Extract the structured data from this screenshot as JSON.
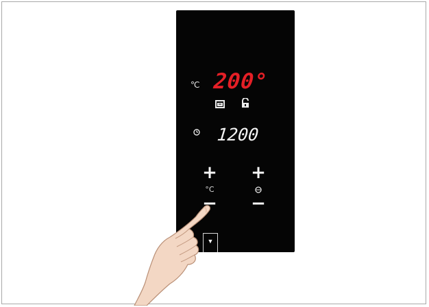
{
  "panel": {
    "temperature": {
      "unit_label": "°C",
      "value": "200°",
      "value_color": "#e41f26"
    },
    "indicators": {
      "oven_icon": "oven-mode-icon",
      "lock_icon": "child-lock-icon"
    },
    "timer": {
      "icon": "clock-icon",
      "value": "1200"
    },
    "controls": {
      "temp_plus": "+",
      "temp_label": "°C",
      "temp_minus": "−",
      "timer_plus": "+",
      "timer_label_icon": "clock-icon",
      "timer_minus": "−",
      "bottom_key": "▼"
    }
  }
}
